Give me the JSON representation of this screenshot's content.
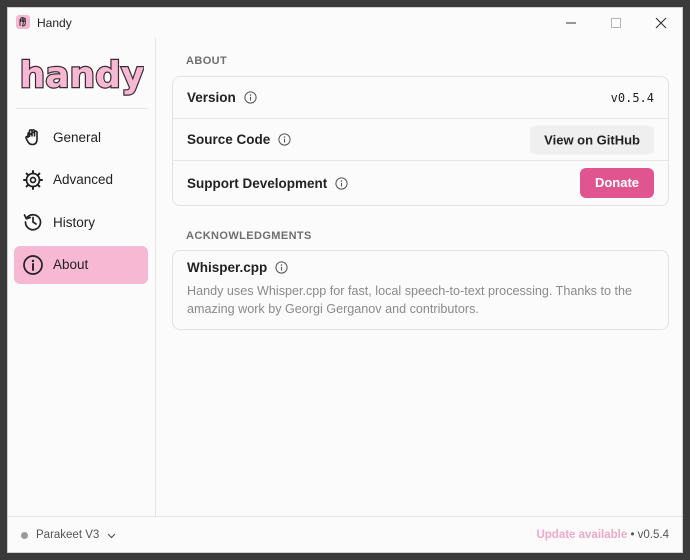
{
  "window": {
    "title": "Handy"
  },
  "sidebar": {
    "logo_text": "handy",
    "items": [
      {
        "label": "General",
        "icon": "hand-icon"
      },
      {
        "label": "Advanced",
        "icon": "gear-icon"
      },
      {
        "label": "History",
        "icon": "history-icon"
      },
      {
        "label": "About",
        "icon": "info-icon",
        "active": true
      }
    ]
  },
  "about": {
    "section_title": "ABOUT",
    "rows": {
      "version": {
        "label": "Version",
        "value": "v0.5.4"
      },
      "source": {
        "label": "Source Code",
        "button": "View on GitHub"
      },
      "support": {
        "label": "Support Development",
        "button": "Donate"
      }
    }
  },
  "acknowledgments": {
    "section_title": "ACKNOWLEDGMENTS",
    "title": "Whisper.cpp",
    "text": "Handy uses Whisper.cpp for fast, local speech-to-text processing. Thanks to the amazing work by Georgi Gerganov and contributors."
  },
  "footer": {
    "model": "Parakeet V3",
    "update_link": "Update available",
    "separator": "•",
    "version": "v0.5.4"
  },
  "colors": {
    "accent": "#e0558f",
    "active_nav": "#f7b8d4",
    "update_link": "#f0a8c8"
  }
}
